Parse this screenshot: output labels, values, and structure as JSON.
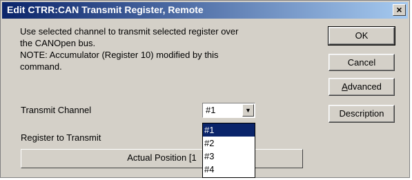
{
  "window": {
    "title": "Edit CTRR:CAN Transmit Register, Remote",
    "close_glyph": "×"
  },
  "description": {
    "line1": "Use selected channel to transmit selected register over",
    "line2": "the CANOpen bus.",
    "line3": "NOTE:  Accumulator (Register 10) modified by this",
    "line4": "command."
  },
  "transmit_channel": {
    "label": "Transmit Channel",
    "value": "#1",
    "options": [
      "#1",
      "#2",
      "#3",
      "#4"
    ],
    "selected_index": 0
  },
  "register": {
    "label": "Register to Transmit",
    "value_visible": "Actual Position [1"
  },
  "buttons": {
    "ok": "OK",
    "cancel": "Cancel",
    "advanced_prefix": "A",
    "advanced_rest": "dvanced",
    "description": "Description"
  }
}
